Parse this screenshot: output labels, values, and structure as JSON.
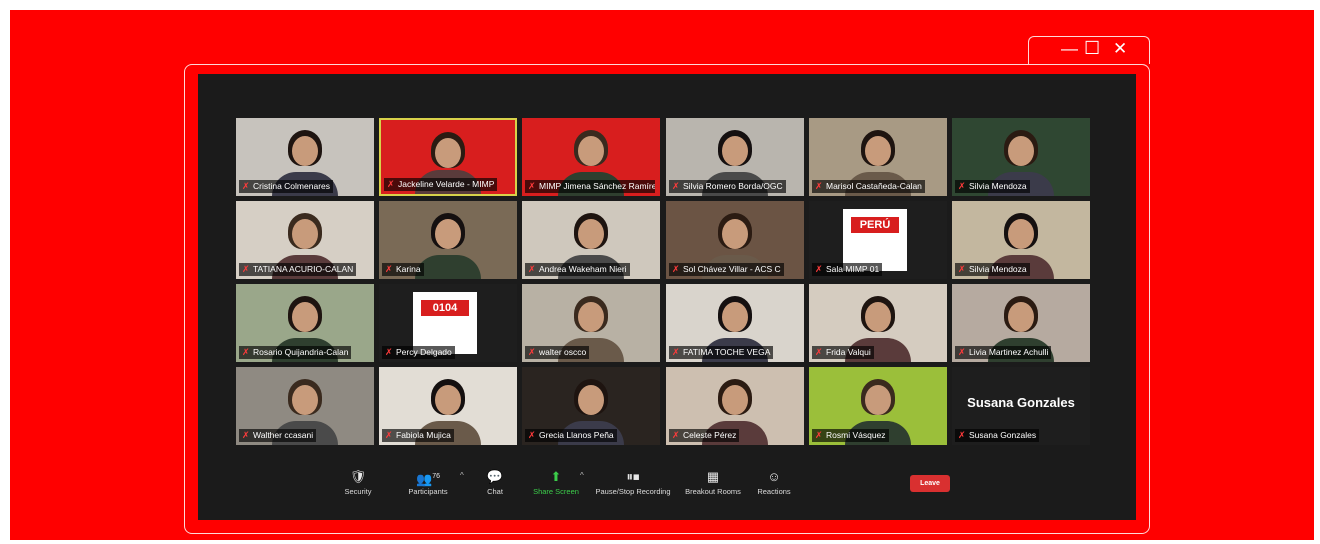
{
  "window_controls": {
    "minimize": "—",
    "maximize": "☐",
    "close": "✕"
  },
  "colors": {
    "brand_red": "#ff0000",
    "app_bg": "#1b1b1b",
    "share_green": "#3ccd4a",
    "leave_red": "#d93030",
    "active_border": "#d8d24a"
  },
  "participants": [
    {
      "name": "Cristina Colmenares",
      "bg": "#c7c3bd"
    },
    {
      "name": "Jackeline Velarde - MIMP",
      "bg": "#d81e1e",
      "active": true
    },
    {
      "name": "MIMP Jimena Sánchez Ramírez",
      "bg": "#d81e1e"
    },
    {
      "name": "Silvia Romero Borda/OGC",
      "bg": "#b9b5ae"
    },
    {
      "name": "Marisol Castañeda-Calan",
      "bg": "#a89a84"
    },
    {
      "name": "Silvia Mendoza",
      "bg": "#2f4732"
    },
    {
      "name": "TATIANA ACURIO-CALAN",
      "bg": "#d6cfc5"
    },
    {
      "name": "Karina",
      "bg": "#7a6a56"
    },
    {
      "name": "Andrea Wakeham Nieri",
      "bg": "#cfc8bd"
    },
    {
      "name": "Sol Chávez Villar - ACS C",
      "bg": "#6b5444"
    },
    {
      "name": "Sala MIMP 01",
      "bg": "#1e1e1e",
      "logo": "PERÚ"
    },
    {
      "name": "Silvia Mendoza",
      "bg": "#c3b79f"
    },
    {
      "name": "Rosario Quijandria-Calan",
      "bg": "#9aa78a"
    },
    {
      "name": "Percy Delgado",
      "bg": "#1e1e1e",
      "logo": "0104"
    },
    {
      "name": "walter oscco",
      "bg": "#b8b1a4"
    },
    {
      "name": "FATIMA TOCHE VEGA",
      "bg": "#d9d4cc"
    },
    {
      "name": "Frida Valqui",
      "bg": "#d5ccc0"
    },
    {
      "name": "Livia Martinez Achulli",
      "bg": "#b6aaa0"
    },
    {
      "name": "Walther ccasani",
      "bg": "#8f8a82"
    },
    {
      "name": "Fabiola Mujica",
      "bg": "#e2ddd5"
    },
    {
      "name": "Grecia Llanos Peña",
      "bg": "#2a2420"
    },
    {
      "name": "Celeste Pérez",
      "bg": "#cdbfb0"
    },
    {
      "name": "Rosmi Vásquez",
      "bg": "#9bbf3a"
    },
    {
      "name": "Susana Gonzales",
      "bg": "#1e1e1e",
      "big_name": "Susana Gonzales"
    }
  ],
  "toolbar": {
    "security": "Security",
    "participants": "Participants",
    "participants_count": "76",
    "chat": "Chat",
    "share_screen": "Share Screen",
    "recording": "Pause/Stop Recording",
    "breakout": "Breakout Rooms",
    "reactions": "Reactions",
    "leave": "Leave"
  },
  "icons": {
    "security": "shield-icon",
    "participants": "people-icon",
    "chat": "chat-bubble-icon",
    "share": "share-screen-icon",
    "recording": "pause-stop-icon",
    "breakout": "grid-icon",
    "reactions": "smiley-icon",
    "mute": "mic-muted-icon"
  }
}
